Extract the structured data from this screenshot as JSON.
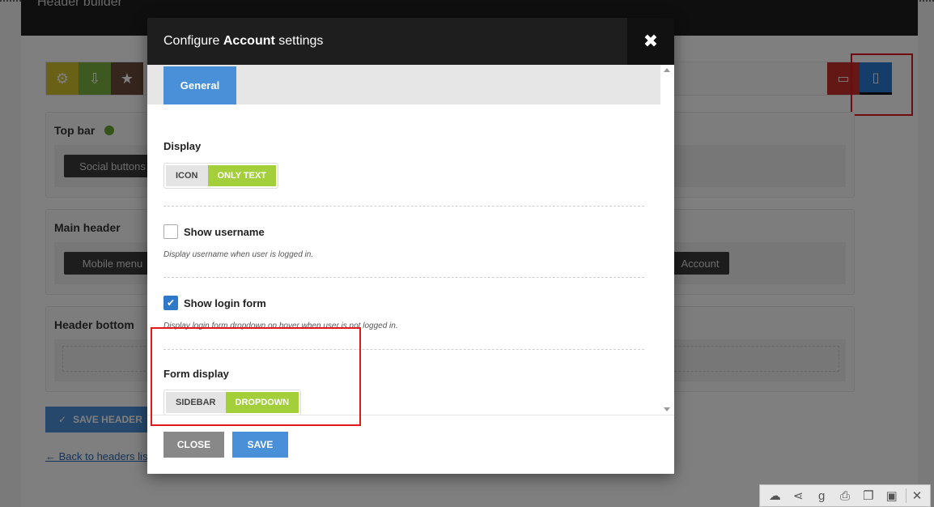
{
  "background": {
    "page_title": "Header builder",
    "sections": {
      "top_bar": {
        "title": "Top bar",
        "chip": "Social buttons"
      },
      "main_header": {
        "title": "Main header",
        "chip_left": "Mobile menu",
        "chip_right": "Account"
      },
      "header_bottom": {
        "title": "Header bottom"
      }
    },
    "save_header_label": "SAVE HEADER",
    "back_link_label": "← Back to headers list",
    "toolbar_icons": [
      "gear-icon",
      "download-icon",
      "star-icon",
      "desktop-icon",
      "mobile-icon"
    ]
  },
  "modal": {
    "title_prefix": "Configure ",
    "title_bold": "Account",
    "title_suffix": " settings",
    "close_glyph": "✖",
    "tabs": [
      {
        "label": "General",
        "active": true
      }
    ],
    "display": {
      "label": "Display",
      "options": [
        {
          "label": "ICON",
          "selected": false
        },
        {
          "label": "ONLY TEXT",
          "selected": true
        }
      ]
    },
    "show_username": {
      "label": "Show username",
      "checked": false,
      "hint": "Display username when user is logged in."
    },
    "show_login_form": {
      "label": "Show login form",
      "checked": true,
      "hint": "Display login form dropdown on hover when user is not logged in."
    },
    "form_display": {
      "label": "Form display",
      "options": [
        {
          "label": "SIDEBAR",
          "selected": false
        },
        {
          "label": "DROPDOWN",
          "selected": true
        }
      ]
    },
    "buttons": {
      "close": "CLOSE",
      "save": "SAVE"
    }
  },
  "colors": {
    "accent_blue": "#4a90d9",
    "selected_green": "#a3cf3b",
    "annotation_red": "#e0191b"
  }
}
